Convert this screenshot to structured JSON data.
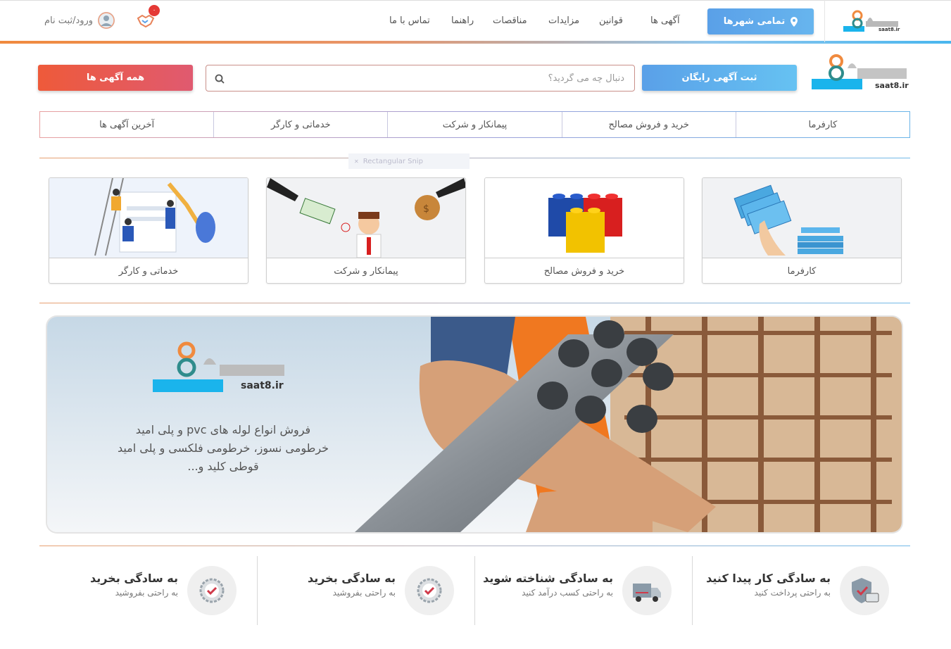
{
  "header": {
    "logo_text": "saat8.ir",
    "cities_button": "تمامی شهرها",
    "nav": [
      "آگهی ها",
      "قوانین",
      "مزایدات",
      "مناقصات",
      "راهنما",
      "تماس با ما"
    ],
    "notification_count": "۰",
    "login_label": "ورود/ثبت نام"
  },
  "search": {
    "placeholder": "دنبال چه می گردید؟",
    "free_ad_button": "ثبت آگهی رایگان",
    "all_ads_button": "همه آگهی ها",
    "logo_text": "saat8.ir"
  },
  "tabs": [
    "کارفرما",
    "خرید و فروش مصالح",
    "پیمانکار و شرکت",
    "خدماتی و کارگر",
    "آخرین آگهی ها"
  ],
  "ghost_label": "Rectangular Snip",
  "categories": [
    {
      "label": "کارفرما",
      "icon": "money-hand-icon"
    },
    {
      "label": "خرید و فروش مصالح",
      "icon": "building-blocks-icon"
    },
    {
      "label": "پیمانکار و شرکت",
      "icon": "contractor-money-icon"
    },
    {
      "label": "خدماتی و کارگر",
      "icon": "workers-icon"
    }
  ],
  "banner": {
    "logo_text": "saat8.ir",
    "line1": "فروش انواع لوله های pvc و پلی امید",
    "line2": "خرطومی نسوز، خرطومی فلکسی و پلی امید",
    "line3": "قوطی کلید و..."
  },
  "features": [
    {
      "title": "به سادگی کار پیدا کنید",
      "subtitle": "به راحتی پرداخت کنید",
      "icon": "secure-card-icon"
    },
    {
      "title": "به سادگی شناخته شوید",
      "subtitle": "به راحتی کسب درآمد کنید",
      "icon": "truck-icon"
    },
    {
      "title": "به سادگی بخرید",
      "subtitle": "به راحتی بفروشید",
      "icon": "badge-check-icon"
    },
    {
      "title": "به سادگی بخرید",
      "subtitle": "به راحتی بفروشید",
      "icon": "badge-check-icon"
    }
  ],
  "colors": {
    "accent_blue": "#5aa0e8",
    "accent_red": "#ee5a3a",
    "logo_cyan": "#1ab4ec"
  }
}
